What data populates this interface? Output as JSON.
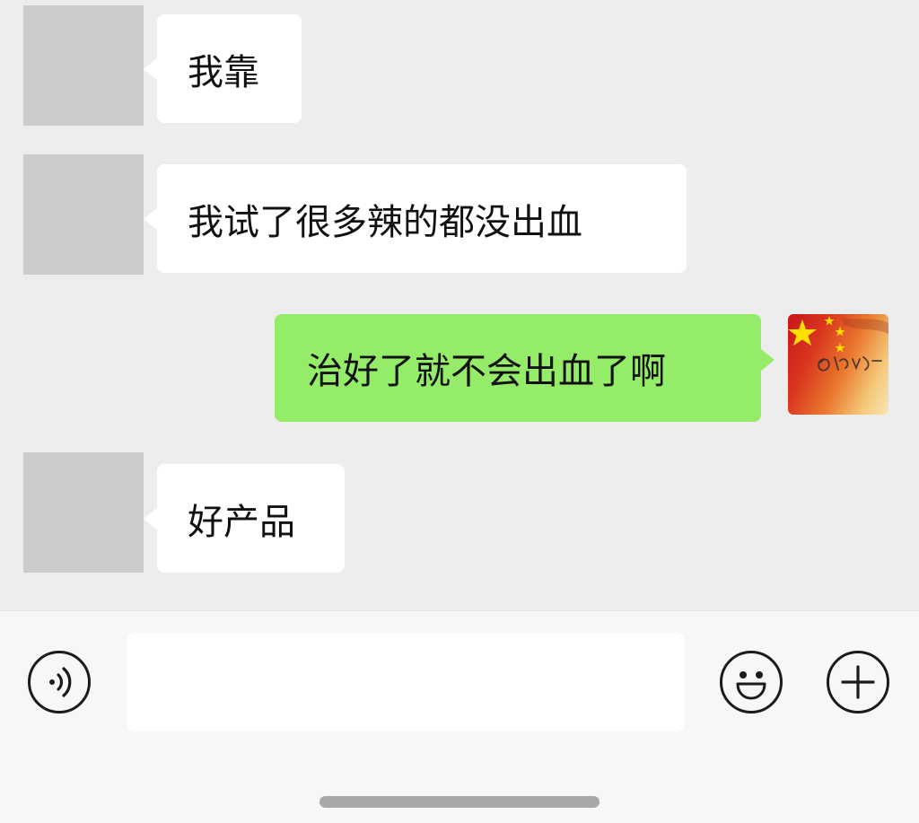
{
  "messages": [
    {
      "sender": "other",
      "text": "我靠"
    },
    {
      "sender": "other",
      "text": "我试了很多辣的都没出血"
    },
    {
      "sender": "self",
      "text": "治好了就不会出血了啊"
    },
    {
      "sender": "other",
      "text": "好产品"
    }
  ],
  "input": {
    "value": "",
    "placeholder": ""
  },
  "icons": {
    "voice": "voice-icon",
    "emoji": "emoji-icon",
    "more": "plus-icon"
  },
  "colors": {
    "chat_background": "#ededed",
    "incoming_bubble": "#ffffff",
    "outgoing_bubble": "#95ec69",
    "placeholder_avatar": "#cccccc",
    "input_bar": "#f7f7f7"
  }
}
